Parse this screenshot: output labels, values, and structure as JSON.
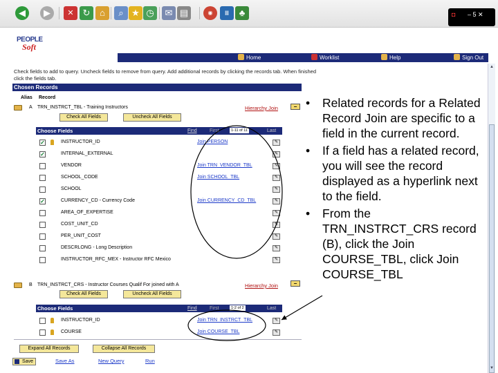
{
  "corner": {
    "label": "– 5 ✕"
  },
  "logo": {
    "top": "PEOPLE",
    "bottom": "Soft"
  },
  "nav": {
    "home": "Home",
    "worklist": "Worklist",
    "help": "Help",
    "signout": "Sign Out"
  },
  "instructions": "Check fields to add to query. Uncheck fields to remove from query. Add additional records by clicking the records tab. When finished click the fields tab.",
  "chosen": {
    "header": "Chosen Records",
    "alias_col": "Alias",
    "record_col": "Record"
  },
  "records": [
    {
      "alias": "A",
      "name": "TRN_INSTRCT_TBL - Training Instructors",
      "hier": "Hierarchy Join",
      "check_all": "Check All Fields",
      "uncheck_all": "Uncheck All Fields",
      "choose": "Choose Fields",
      "find": "Find",
      "first": "First",
      "range": "1-11 of 11",
      "last": "Last",
      "fields": [
        {
          "name": "INSTRUCTOR_ID",
          "checked": true,
          "key": true,
          "join": "Join PERSON"
        },
        {
          "name": "INTERNAL_EXTERNAL",
          "checked": true,
          "key": false,
          "join": ""
        },
        {
          "name": "VENDOR",
          "checked": false,
          "key": false,
          "join": "Join TRN_VENDOR_TBL"
        },
        {
          "name": "SCHOOL_CODE",
          "checked": false,
          "key": false,
          "join": "Join SCHOOL_TBL"
        },
        {
          "name": "SCHOOL",
          "checked": false,
          "key": false,
          "join": ""
        },
        {
          "name": "CURRENCY_CD - Currency Code",
          "checked": true,
          "key": false,
          "join": "Join CURRENCY_CD_TBL"
        },
        {
          "name": "AREA_OF_EXPERTISE",
          "checked": false,
          "key": false,
          "join": ""
        },
        {
          "name": "COST_UNIT_CD",
          "checked": false,
          "key": false,
          "join": ""
        },
        {
          "name": "PER_UNIT_COST",
          "checked": false,
          "key": false,
          "join": ""
        },
        {
          "name": "DESCRLONG - Long Description",
          "checked": false,
          "key": false,
          "join": ""
        },
        {
          "name": "INSTRUCTOR_RFC_MEX - Instructor RFC Mexico",
          "checked": false,
          "key": false,
          "join": ""
        }
      ]
    },
    {
      "alias": "B",
      "name": "TRN_INSTRCT_CRS - Instructor Courses Qualif For joined with A",
      "hier": "Hierarchy Join",
      "check_all": "Check All Fields",
      "uncheck_all": "Uncheck All Fields",
      "choose": "Choose Fields",
      "find": "Find",
      "first": "First",
      "range": "1-2 of 2",
      "last": "Last",
      "fields": [
        {
          "name": "INSTRUCTOR_ID",
          "checked": false,
          "key": true,
          "join": "Join TRN_INSTRCT_TBL"
        },
        {
          "name": "COURSE",
          "checked": false,
          "key": true,
          "join": "Join COURSE_TBL"
        }
      ]
    }
  ],
  "buttons": {
    "expand": "Expand All Records",
    "collapse": "Collapse All Records",
    "save": "Save",
    "save_as": "Save As",
    "new_query": "New Query",
    "run": "Run"
  },
  "bullets": [
    "Related records for a Related Record Join are specific to a field in the current record.",
    "If a field has a related record, you will see the record displayed as a hyperlink next to the field.",
    "From the TRN_INSTRCT_CRS record (B), click the Join COURSE_TBL, click Join COURSE_TBL"
  ],
  "colors": {
    "nav": "#1c2a78",
    "link": "#1a38c8",
    "button": "#f4e79a",
    "hier": "#b01010"
  }
}
